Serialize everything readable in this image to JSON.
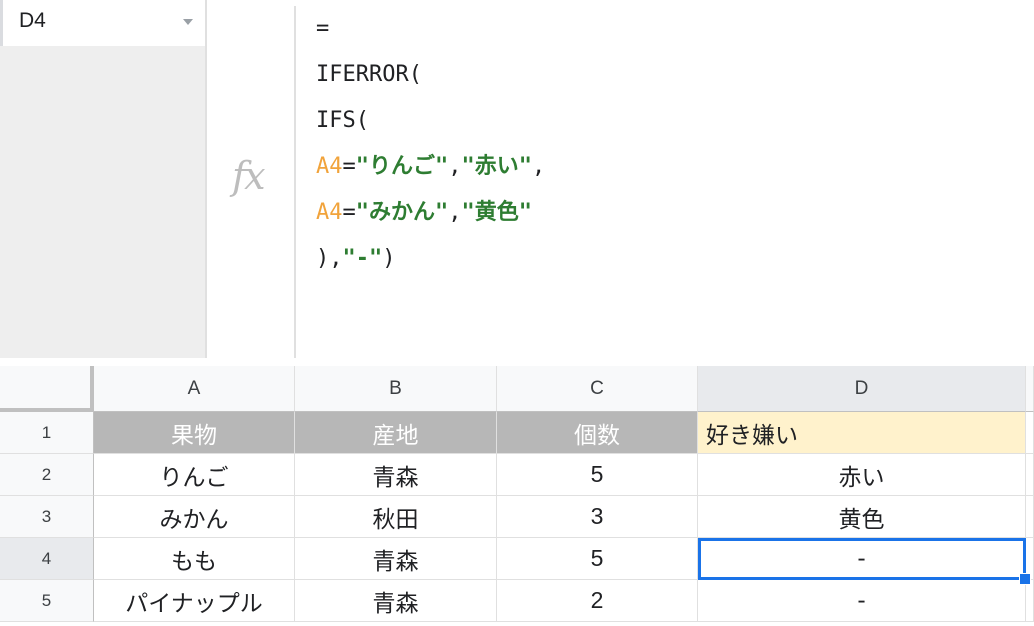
{
  "namebox": {
    "ref": "D4"
  },
  "fx_icon": "fx",
  "formula_lines": [
    [
      {
        "t": "=",
        "c": "plain"
      }
    ],
    [
      {
        "t": "IFERROR(",
        "c": "plain"
      }
    ],
    [
      {
        "t": "IFS(",
        "c": "plain"
      }
    ],
    [
      {
        "t": "A4",
        "c": "ref"
      },
      {
        "t": "=",
        "c": "plain"
      },
      {
        "t": "\"りんご\"",
        "c": "str"
      },
      {
        "t": ",",
        "c": "plain"
      },
      {
        "t": "\"赤い\"",
        "c": "str"
      },
      {
        "t": ",",
        "c": "plain"
      }
    ],
    [
      {
        "t": "A4",
        "c": "ref"
      },
      {
        "t": "=",
        "c": "plain"
      },
      {
        "t": "\"みかん\"",
        "c": "str"
      },
      {
        "t": ",",
        "c": "plain"
      },
      {
        "t": "\"黄色\"",
        "c": "str"
      }
    ],
    [
      {
        "t": "),",
        "c": "plain"
      },
      {
        "t": "\"-\"",
        "c": "str"
      },
      {
        "t": ")",
        "c": "plain"
      }
    ]
  ],
  "colors": {
    "ref": "#f1a33b",
    "str": "#2e7d32",
    "selection": "#1a73e8",
    "header_fill": "#b7b7b7",
    "highlight_fill": "#fff2cc"
  },
  "columns": [
    "A",
    "B",
    "C",
    "D"
  ],
  "rows": [
    "1",
    "2",
    "3",
    "4",
    "5"
  ],
  "cells": [
    [
      "果物",
      "産地",
      "個数",
      "好き嫌い"
    ],
    [
      "りんご",
      "青森",
      "5",
      "赤い"
    ],
    [
      "みかん",
      "秋田",
      "3",
      "黄色"
    ],
    [
      "もも",
      "青森",
      "5",
      "-"
    ],
    [
      "パイナップル",
      "青森",
      "2",
      "-"
    ]
  ],
  "selected_cell": "D4"
}
